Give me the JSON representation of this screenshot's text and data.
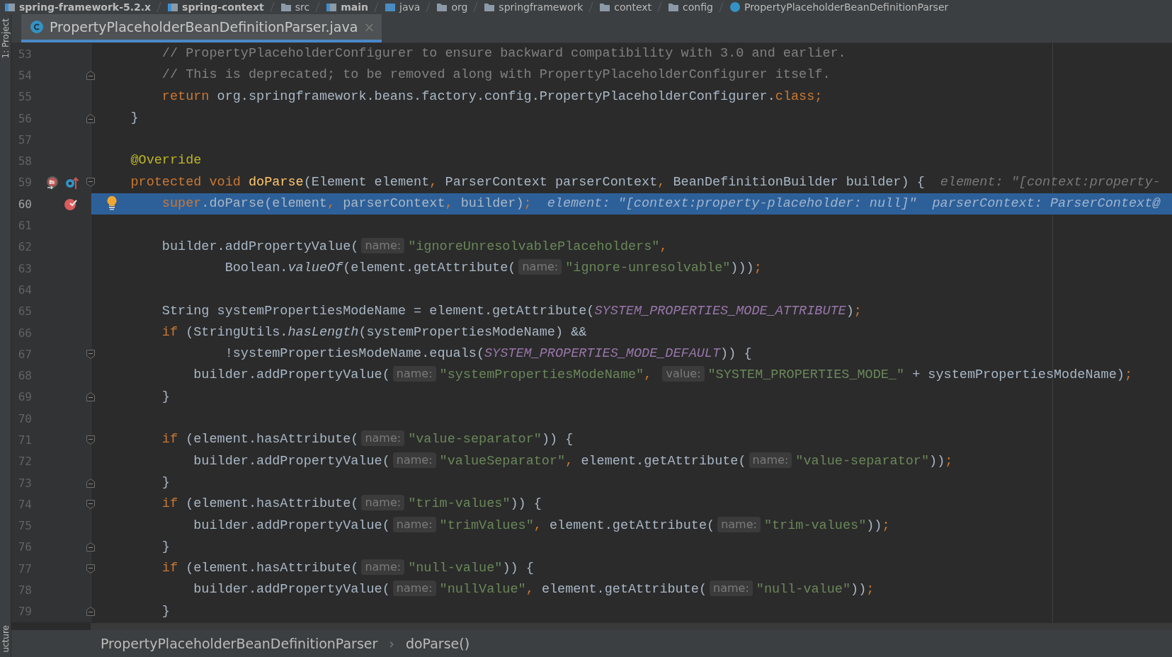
{
  "navigation_bar": {
    "items": [
      {
        "kind": "module",
        "label": "spring-framework-5.2.x"
      },
      {
        "kind": "module",
        "label": "spring-context"
      },
      {
        "kind": "folder",
        "label": "src"
      },
      {
        "kind": "module",
        "label": "main"
      },
      {
        "kind": "source",
        "label": "java"
      },
      {
        "kind": "folder",
        "label": "org"
      },
      {
        "kind": "folder",
        "label": "springframework"
      },
      {
        "kind": "folder",
        "label": "context"
      },
      {
        "kind": "folder",
        "label": "config"
      },
      {
        "kind": "class",
        "label": "PropertyPlaceholderBeanDefinitionParser"
      }
    ]
  },
  "tool_strip": {
    "top_label": "1: Project",
    "bottom_label": "ucture"
  },
  "tabs": [
    {
      "label": "PropertyPlaceholderBeanDefinitionParser.java",
      "close": "×",
      "selected": true
    }
  ],
  "editor": {
    "lines": [
      {
        "number": "53",
        "selected": false,
        "tokens": [
          {
            "kind": "comment",
            "text": "        // PropertyPlaceholderConfigurer to ensure backward compatibility with 3.0 and earlier."
          }
        ]
      },
      {
        "number": "54",
        "selected": false,
        "fold": {
          "kind": "end"
        },
        "tokens": [
          {
            "kind": "comment",
            "text": "        // This is deprecated; to be removed along with PropertyPlaceholderConfigurer itself."
          }
        ]
      },
      {
        "number": "55",
        "selected": false,
        "tokens": [
          {
            "kind": "keyword",
            "text": "        return"
          },
          {
            "kind": "plain",
            "text": " org.springframework.beans.factory.config.PropertyPlaceholderConfigurer."
          },
          {
            "kind": "keyword",
            "text": "class"
          },
          {
            "kind": "punct",
            "text": ";"
          }
        ]
      },
      {
        "number": "56",
        "selected": false,
        "fold": {
          "kind": "end"
        },
        "tokens": [
          {
            "kind": "plain",
            "text": "    }"
          }
        ]
      },
      {
        "number": "57",
        "selected": false
      },
      {
        "number": "58",
        "selected": false,
        "tokens": [
          {
            "kind": "annotation",
            "text": "    @Override"
          }
        ]
      },
      {
        "number": "59",
        "selected": false,
        "fold": {
          "kind": "start"
        },
        "gutter_icons": [
          {
            "kind": "overriding"
          },
          {
            "kind": "implemented"
          }
        ],
        "tokens": [
          {
            "kind": "keyword",
            "text": "    protected void "
          },
          {
            "kind": "declaration",
            "text": "doParse"
          },
          {
            "kind": "plain",
            "text": "(Element element"
          },
          {
            "kind": "punct",
            "text": ","
          },
          {
            "kind": "plain",
            "text": " ParserContext parserContext"
          },
          {
            "kind": "punct",
            "text": ","
          },
          {
            "kind": "plain",
            "text": " BeanDefinitionBuilder builder) {"
          },
          {
            "kind": "debug",
            "text": "element: \"[context:property-"
          }
        ]
      },
      {
        "number": "60",
        "selected": true,
        "gutter_icons": [
          {
            "kind": "breakpoint"
          },
          {
            "kind": "bulb"
          }
        ],
        "tokens": [
          {
            "kind": "keyword",
            "text": "        super"
          },
          {
            "kind": "plain",
            "text": ".doParse(element"
          },
          {
            "kind": "punct",
            "text": ","
          },
          {
            "kind": "plain",
            "text": " parserContext"
          },
          {
            "kind": "punct",
            "text": ","
          },
          {
            "kind": "plain",
            "text": " builder)"
          },
          {
            "kind": "punct",
            "text": ";"
          },
          {
            "kind": "debug",
            "text": "element: \"[context:property-placeholder: null]\""
          },
          {
            "kind": "debug",
            "text": "parserContext: ParserContext@"
          }
        ]
      },
      {
        "number": "61",
        "selected": false
      },
      {
        "number": "62",
        "selected": false,
        "tokens": [
          {
            "kind": "plain",
            "text": "        builder.addPropertyValue("
          },
          {
            "kind": "hint",
            "text": "name:"
          },
          {
            "kind": "string",
            "text": "\"ignoreUnresolvablePlaceholders\""
          },
          {
            "kind": "punct",
            "text": ","
          }
        ]
      },
      {
        "number": "63",
        "selected": false,
        "tokens": [
          {
            "kind": "plain",
            "text": "                Boolean."
          },
          {
            "kind": "static",
            "text": "valueOf"
          },
          {
            "kind": "plain",
            "text": "(element.getAttribute("
          },
          {
            "kind": "hint",
            "text": "name:"
          },
          {
            "kind": "string",
            "text": "\"ignore-unresolvable\""
          },
          {
            "kind": "plain",
            "text": ")))"
          },
          {
            "kind": "punct",
            "text": ";"
          }
        ]
      },
      {
        "number": "64",
        "selected": false
      },
      {
        "number": "65",
        "selected": false,
        "tokens": [
          {
            "kind": "plain",
            "text": "        String systemPropertiesModeName = element.getAttribute("
          },
          {
            "kind": "constant",
            "text": "SYSTEM_PROPERTIES_MODE_ATTRIBUTE"
          },
          {
            "kind": "plain",
            "text": ")"
          },
          {
            "kind": "punct",
            "text": ";"
          }
        ]
      },
      {
        "number": "66",
        "selected": false,
        "tokens": [
          {
            "kind": "keyword",
            "text": "        if"
          },
          {
            "kind": "plain",
            "text": " (StringUtils."
          },
          {
            "kind": "static",
            "text": "hasLength"
          },
          {
            "kind": "plain",
            "text": "(systemPropertiesModeName) &&"
          }
        ]
      },
      {
        "number": "67",
        "selected": false,
        "fold": {
          "kind": "start"
        },
        "tokens": [
          {
            "kind": "plain",
            "text": "                !systemPropertiesModeName.equals("
          },
          {
            "kind": "constant",
            "text": "SYSTEM_PROPERTIES_MODE_DEFAULT"
          },
          {
            "kind": "plain",
            "text": ")) {"
          }
        ]
      },
      {
        "number": "68",
        "selected": false,
        "tokens": [
          {
            "kind": "plain",
            "text": "            builder.addPropertyValue("
          },
          {
            "kind": "hint",
            "text": "name:"
          },
          {
            "kind": "string",
            "text": "\"systemPropertiesModeName\""
          },
          {
            "kind": "punct",
            "text": ", "
          },
          {
            "kind": "hint",
            "text": "value:"
          },
          {
            "kind": "string",
            "text": "\"SYSTEM_PROPERTIES_MODE_\""
          },
          {
            "kind": "plain",
            "text": " + systemPropertiesModeName)"
          },
          {
            "kind": "punct",
            "text": ";"
          }
        ]
      },
      {
        "number": "69",
        "selected": false,
        "fold": {
          "kind": "end"
        },
        "tokens": [
          {
            "kind": "plain",
            "text": "        }"
          }
        ]
      },
      {
        "number": "70",
        "selected": false
      },
      {
        "number": "71",
        "selected": false,
        "fold": {
          "kind": "start"
        },
        "tokens": [
          {
            "kind": "keyword",
            "text": "        if"
          },
          {
            "kind": "plain",
            "text": " (element.hasAttribute("
          },
          {
            "kind": "hint",
            "text": "name:"
          },
          {
            "kind": "string",
            "text": "\"value-separator\""
          },
          {
            "kind": "plain",
            "text": ")) {"
          }
        ]
      },
      {
        "number": "72",
        "selected": false,
        "tokens": [
          {
            "kind": "plain",
            "text": "            builder.addPropertyValue("
          },
          {
            "kind": "hint",
            "text": "name:"
          },
          {
            "kind": "string",
            "text": "\"valueSeparator\""
          },
          {
            "kind": "punct",
            "text": ","
          },
          {
            "kind": "plain",
            "text": " element.getAttribute("
          },
          {
            "kind": "hint",
            "text": "name:"
          },
          {
            "kind": "string",
            "text": "\"value-separator\""
          },
          {
            "kind": "plain",
            "text": "))"
          },
          {
            "kind": "punct",
            "text": ";"
          }
        ]
      },
      {
        "number": "73",
        "selected": false,
        "fold": {
          "kind": "end"
        },
        "tokens": [
          {
            "kind": "plain",
            "text": "        }"
          }
        ]
      },
      {
        "number": "74",
        "selected": false,
        "fold": {
          "kind": "start"
        },
        "tokens": [
          {
            "kind": "keyword",
            "text": "        if"
          },
          {
            "kind": "plain",
            "text": " (element.hasAttribute("
          },
          {
            "kind": "hint",
            "text": "name:"
          },
          {
            "kind": "string",
            "text": "\"trim-values\""
          },
          {
            "kind": "plain",
            "text": ")) {"
          }
        ]
      },
      {
        "number": "75",
        "selected": false,
        "tokens": [
          {
            "kind": "plain",
            "text": "            builder.addPropertyValue("
          },
          {
            "kind": "hint",
            "text": "name:"
          },
          {
            "kind": "string",
            "text": "\"trimValues\""
          },
          {
            "kind": "punct",
            "text": ","
          },
          {
            "kind": "plain",
            "text": " element.getAttribute("
          },
          {
            "kind": "hint",
            "text": "name:"
          },
          {
            "kind": "string",
            "text": "\"trim-values\""
          },
          {
            "kind": "plain",
            "text": "))"
          },
          {
            "kind": "punct",
            "text": ";"
          }
        ]
      },
      {
        "number": "76",
        "selected": false,
        "fold": {
          "kind": "end"
        },
        "tokens": [
          {
            "kind": "plain",
            "text": "        }"
          }
        ]
      },
      {
        "number": "77",
        "selected": false,
        "fold": {
          "kind": "start"
        },
        "tokens": [
          {
            "kind": "keyword",
            "text": "        if"
          },
          {
            "kind": "plain",
            "text": " (element.hasAttribute("
          },
          {
            "kind": "hint",
            "text": "name:"
          },
          {
            "kind": "string",
            "text": "\"null-value\""
          },
          {
            "kind": "plain",
            "text": ")) {"
          }
        ]
      },
      {
        "number": "78",
        "selected": false,
        "tokens": [
          {
            "kind": "plain",
            "text": "            builder.addPropertyValue("
          },
          {
            "kind": "hint",
            "text": "name:"
          },
          {
            "kind": "string",
            "text": "\"nullValue\""
          },
          {
            "kind": "punct",
            "text": ","
          },
          {
            "kind": "plain",
            "text": " element.getAttribute("
          },
          {
            "kind": "hint",
            "text": "name:"
          },
          {
            "kind": "string",
            "text": "\"null-value\""
          },
          {
            "kind": "plain",
            "text": "))"
          },
          {
            "kind": "punct",
            "text": ";"
          }
        ]
      },
      {
        "number": "79",
        "selected": false,
        "fold": {
          "kind": "end"
        },
        "tokens": [
          {
            "kind": "plain",
            "text": "        }"
          }
        ]
      }
    ]
  },
  "breadcrumbs": {
    "items": [
      "PropertyPlaceholderBeanDefinitionParser",
      "doParse()"
    ],
    "separator": "›"
  }
}
